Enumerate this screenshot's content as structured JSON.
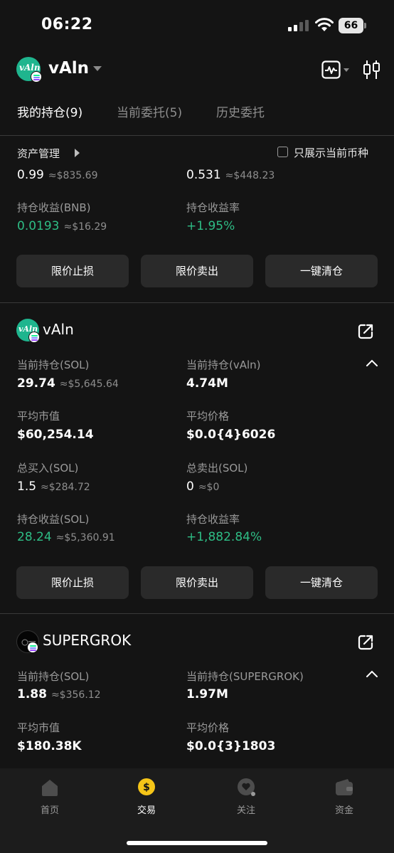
{
  "status_bar": {
    "time": "06:22",
    "battery": "66"
  },
  "header": {
    "token_name": "vAln",
    "token_logo_text": "vAln"
  },
  "tabs": [
    {
      "label": "我的持仓(9)",
      "active": true
    },
    {
      "label": "当前委托(5)",
      "active": false
    },
    {
      "label": "历史委托",
      "active": false
    }
  ],
  "asset_mgmt": {
    "label": "资产管理",
    "checkbox_label": "只展示当前币种"
  },
  "summary": {
    "left_value": "0.99",
    "left_approx": "≈$835.69",
    "right_value": "0.531",
    "right_approx": "≈$448.23",
    "profit_label": "持仓收益(BNB)",
    "profit_value": "0.0193",
    "profit_approx": "≈$16.29",
    "rate_label": "持仓收益率",
    "rate_value": "+1.95%"
  },
  "buttons": {
    "limit_stop": "限价止损",
    "limit_sell": "限价卖出",
    "clear_all": "一键清仓"
  },
  "holding1": {
    "name": "vAln",
    "hold_sol_label": "当前持仓(SOL)",
    "hold_sol_value": "29.74",
    "hold_sol_approx": "≈$5,645.64",
    "hold_token_label": "当前持仓(vAln)",
    "hold_token_value": "4.74M",
    "avg_mcap_label": "平均市值",
    "avg_mcap_value": "$60,254.14",
    "avg_price_label": "平均价格",
    "avg_price_value": "$0.0{4}6026",
    "total_buy_label": "总买入(SOL)",
    "total_buy_value": "1.5",
    "total_buy_approx": "≈$284.72",
    "total_sell_label": "总卖出(SOL)",
    "total_sell_value": "0",
    "total_sell_approx": "≈$0",
    "profit_label": "持仓收益(SOL)",
    "profit_value": "28.24",
    "profit_approx": "≈$5,360.91",
    "rate_label": "持仓收益率",
    "rate_value": "+1,882.84%"
  },
  "holding2": {
    "name": "SUPERGROK",
    "hold_sol_label": "当前持仓(SOL)",
    "hold_sol_value": "1.88",
    "hold_sol_approx": "≈$356.12",
    "hold_token_label": "当前持仓(SUPERGROK)",
    "hold_token_value": "1.97M",
    "avg_mcap_label": "平均市值",
    "avg_mcap_value": "$180.38K",
    "avg_price_label": "平均价格",
    "avg_price_value": "$0.0{3}1803"
  },
  "bottom_nav": [
    {
      "label": "首页",
      "icon": "home-icon",
      "active": false
    },
    {
      "label": "交易",
      "icon": "trade-coin-icon",
      "active": true
    },
    {
      "label": "关注",
      "icon": "favorite-icon",
      "active": false
    },
    {
      "label": "资金",
      "icon": "wallet-icon",
      "active": false
    }
  ],
  "colors": {
    "background": "#141414",
    "positive": "#2ebd85",
    "button": "#2a2a2a",
    "accent_yellow": "#f5c518"
  }
}
